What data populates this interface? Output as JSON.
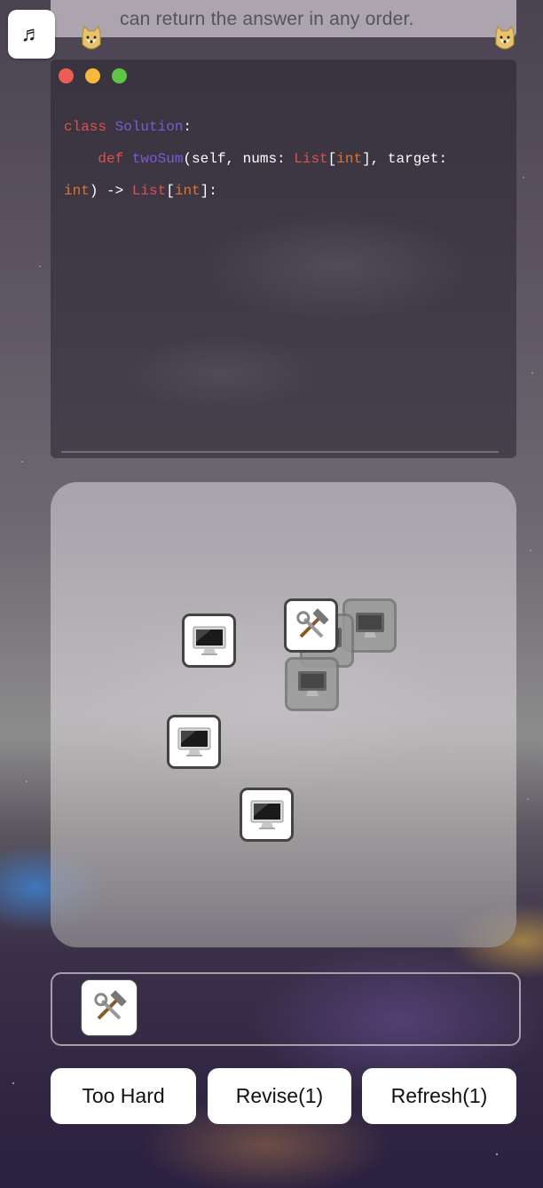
{
  "header": {
    "music_icon": "music-note-icon",
    "problem_text": "can return the answer in any order."
  },
  "editor": {
    "window_dots": [
      "#ee5c54",
      "#f6b93c",
      "#5ec644"
    ],
    "code_lines": [
      {
        "parts": [
          {
            "t": "class ",
            "c": "red"
          },
          {
            "t": "Solution",
            "c": "purple"
          },
          {
            "t": ":",
            "c": "plain"
          }
        ]
      },
      {
        "parts": [
          {
            "t": "    def ",
            "c": "red"
          },
          {
            "t": "twoSum",
            "c": "purple"
          },
          {
            "t": "(self, nums: ",
            "c": "plain"
          },
          {
            "t": "List",
            "c": "red"
          },
          {
            "t": "[",
            "c": "plain"
          },
          {
            "t": "int",
            "c": "orange"
          },
          {
            "t": "], target:",
            "c": "plain"
          }
        ]
      },
      {
        "parts": [
          {
            "t": "int",
            "c": "orange"
          },
          {
            "t": ") -> ",
            "c": "plain"
          },
          {
            "t": "List",
            "c": "red"
          },
          {
            "t": "[",
            "c": "plain"
          },
          {
            "t": "int",
            "c": "orange"
          },
          {
            "t": "]:",
            "c": "plain"
          }
        ]
      }
    ]
  },
  "board": {
    "tiles": [
      {
        "icon": "computer-icon",
        "state": "active"
      },
      {
        "icon": "tools-icon",
        "state": "active"
      },
      {
        "icon": "computer-icon",
        "state": "ghost"
      },
      {
        "icon": "computer-icon",
        "state": "ghost"
      },
      {
        "icon": "computer-icon",
        "state": "ghost"
      },
      {
        "icon": "computer-icon",
        "state": "active"
      },
      {
        "icon": "computer-icon",
        "state": "active"
      }
    ]
  },
  "tray": {
    "slots": [
      {
        "icon": "tools-icon"
      }
    ]
  },
  "actions": {
    "too_hard": "Too Hard",
    "revise": "Revise(1)",
    "refresh": "Refresh(1)"
  }
}
